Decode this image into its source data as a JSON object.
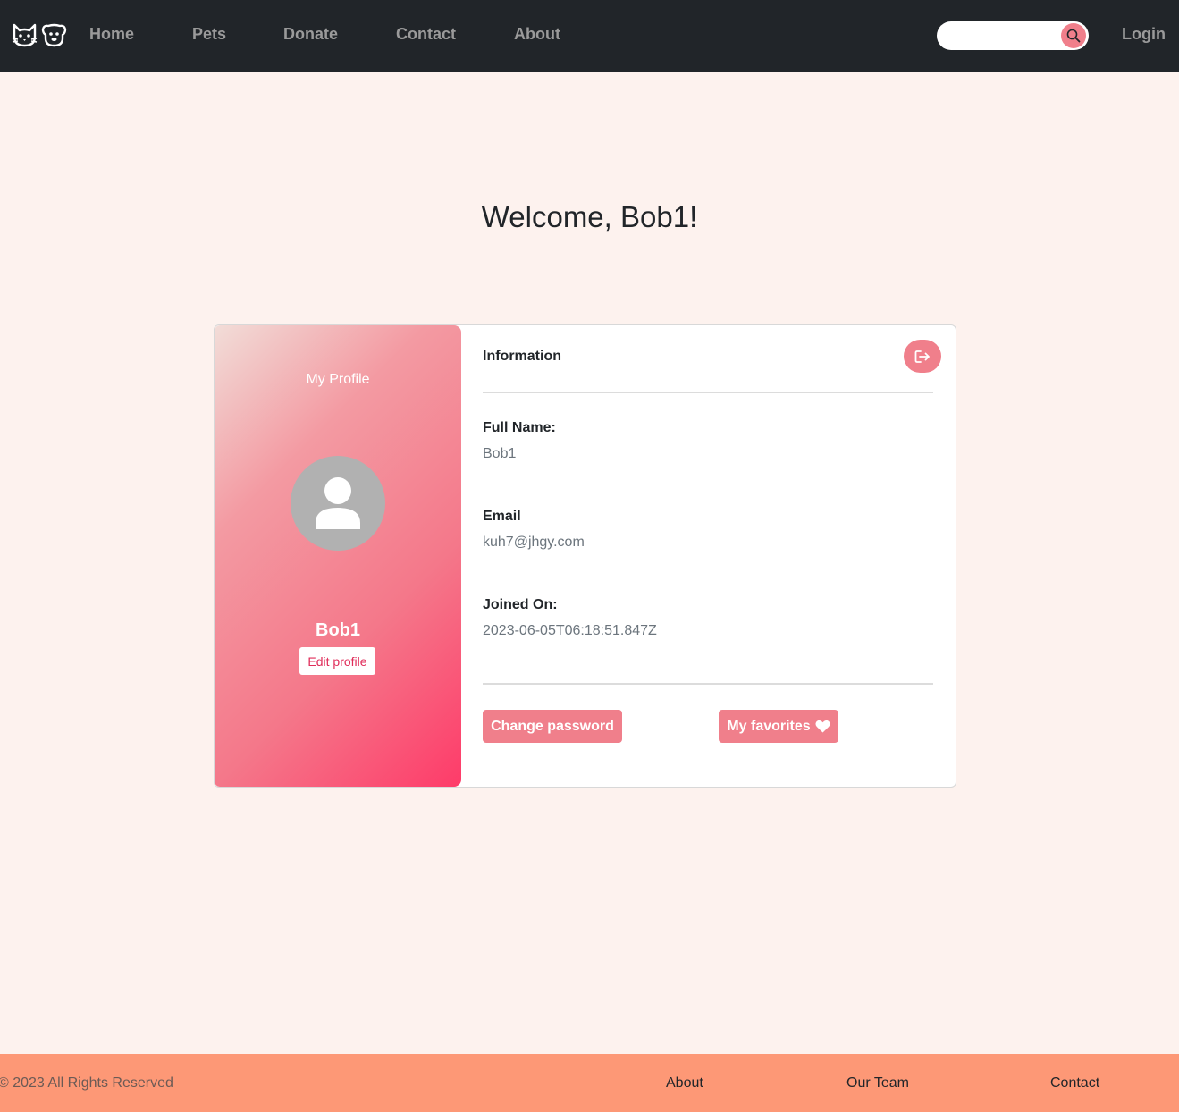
{
  "navbar": {
    "logo_icons": [
      "cat-face-icon",
      "dog-face-icon"
    ],
    "links": [
      "Home",
      "Pets",
      "Donate",
      "Contact",
      "About"
    ],
    "search": {
      "value": "",
      "placeholder": "",
      "icon": "search-icon"
    },
    "login_label": "Login"
  },
  "page": {
    "welcome": "Welcome, Bob1!"
  },
  "profile_card": {
    "left": {
      "heading": "My Profile",
      "avatar_icon": "user-icon",
      "name": "Bob1",
      "edit_label": "Edit profile"
    },
    "right": {
      "title": "Information",
      "logout_icon": "logout-icon",
      "fields": [
        {
          "label": "Full Name:",
          "value": "Bob1"
        },
        {
          "label": "Email",
          "value": "kuh7@jhgy.com"
        },
        {
          "label": "Joined On:",
          "value": "2023-06-05T06:18:51.847Z"
        }
      ],
      "change_password_label": "Change password",
      "favorites_label": "My favorites",
      "favorites_icon": "heart-icon"
    }
  },
  "footer": {
    "copyright": "© 2023 All Rights Reserved",
    "links": [
      "About",
      "Our Team",
      "Contact"
    ]
  },
  "colors": {
    "navbar_bg": "#212529",
    "page_bg": "#fdf2ee",
    "accent": "#f07f8b",
    "footer_bg": "#fd9876",
    "gradient_end": "#fe3b69"
  }
}
